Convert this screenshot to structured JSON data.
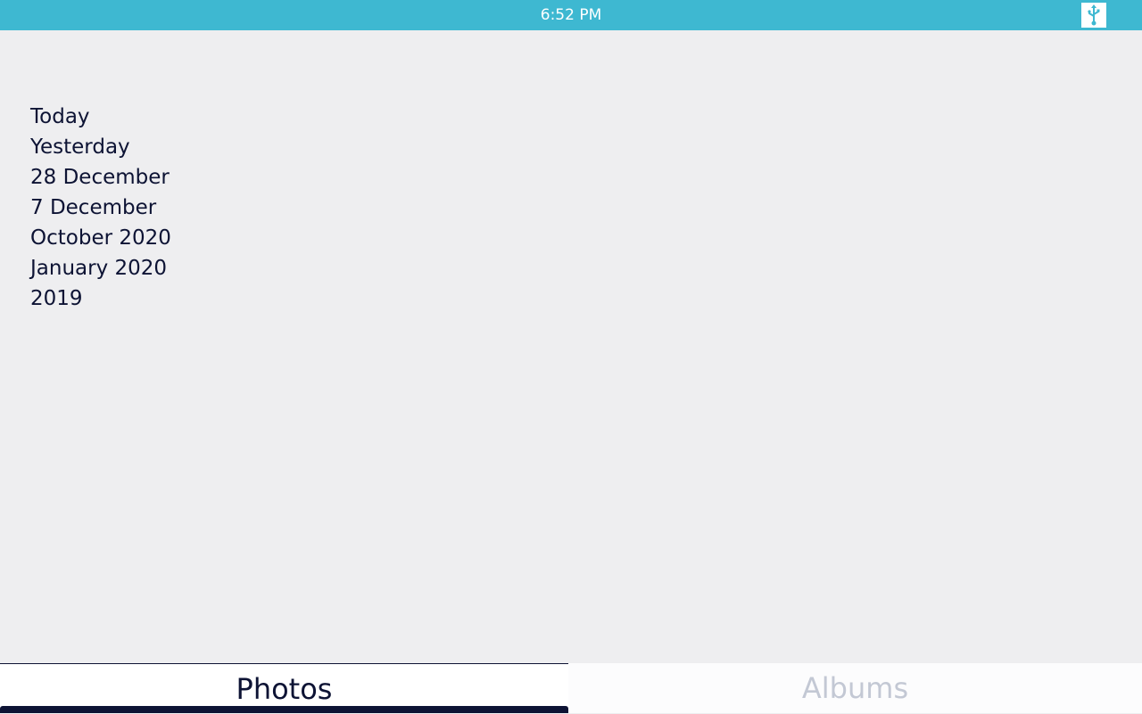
{
  "status_bar": {
    "time": "6:52 PM",
    "icon": "usb-icon",
    "background_color": "#3eb8d1"
  },
  "date_groups": [
    {
      "label": "Today"
    },
    {
      "label": "Yesterday"
    },
    {
      "label": "28 December"
    },
    {
      "label": "7 December"
    },
    {
      "label": "October 2020"
    },
    {
      "label": "January 2020"
    },
    {
      "label": "2019"
    }
  ],
  "tabs": [
    {
      "label": "Photos",
      "selected": true
    },
    {
      "label": "Albums",
      "selected": false
    }
  ],
  "colors": {
    "accent": "#0d1334",
    "inactive_tab_text": "#c3c8d4",
    "content_background": "#eeeef0"
  }
}
